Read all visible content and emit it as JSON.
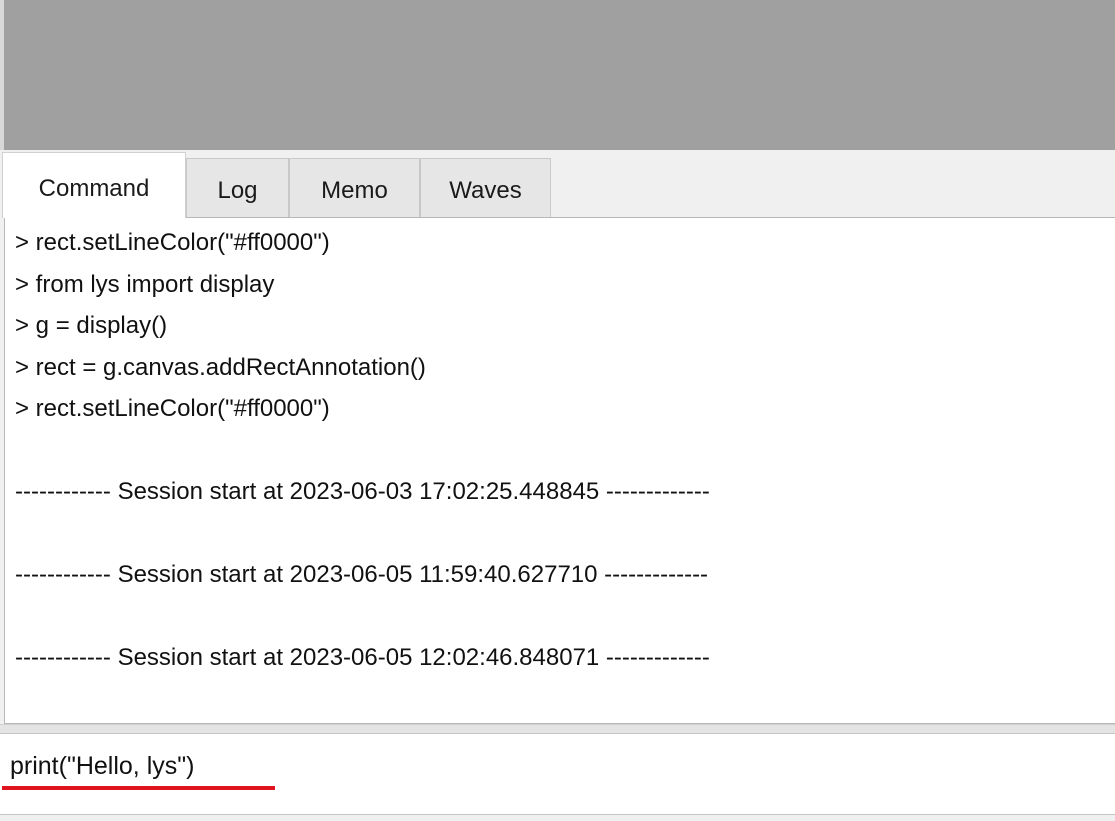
{
  "tabs": [
    {
      "label": "Command",
      "active": true
    },
    {
      "label": "Log",
      "active": false
    },
    {
      "label": "Memo",
      "active": false
    },
    {
      "label": "Waves",
      "active": false
    }
  ],
  "output": {
    "lines": [
      "> rect.setLineColor(\"#ff0000\")",
      "> from lys import display",
      "> g = display()",
      "> rect = g.canvas.addRectAnnotation()",
      "> rect.setLineColor(\"#ff0000\")",
      "",
      "------------ Session start at 2023-06-03 17:02:25.448845 -------------",
      "",
      "------------ Session start at 2023-06-05 11:59:40.627710 -------------",
      "",
      "------------ Session start at 2023-06-05 12:02:46.848071 -------------"
    ]
  },
  "input": {
    "value": "print(\"Hello, lys\")"
  },
  "colors": {
    "top_area": "#a0a0a0",
    "underline": "#e0141e"
  }
}
